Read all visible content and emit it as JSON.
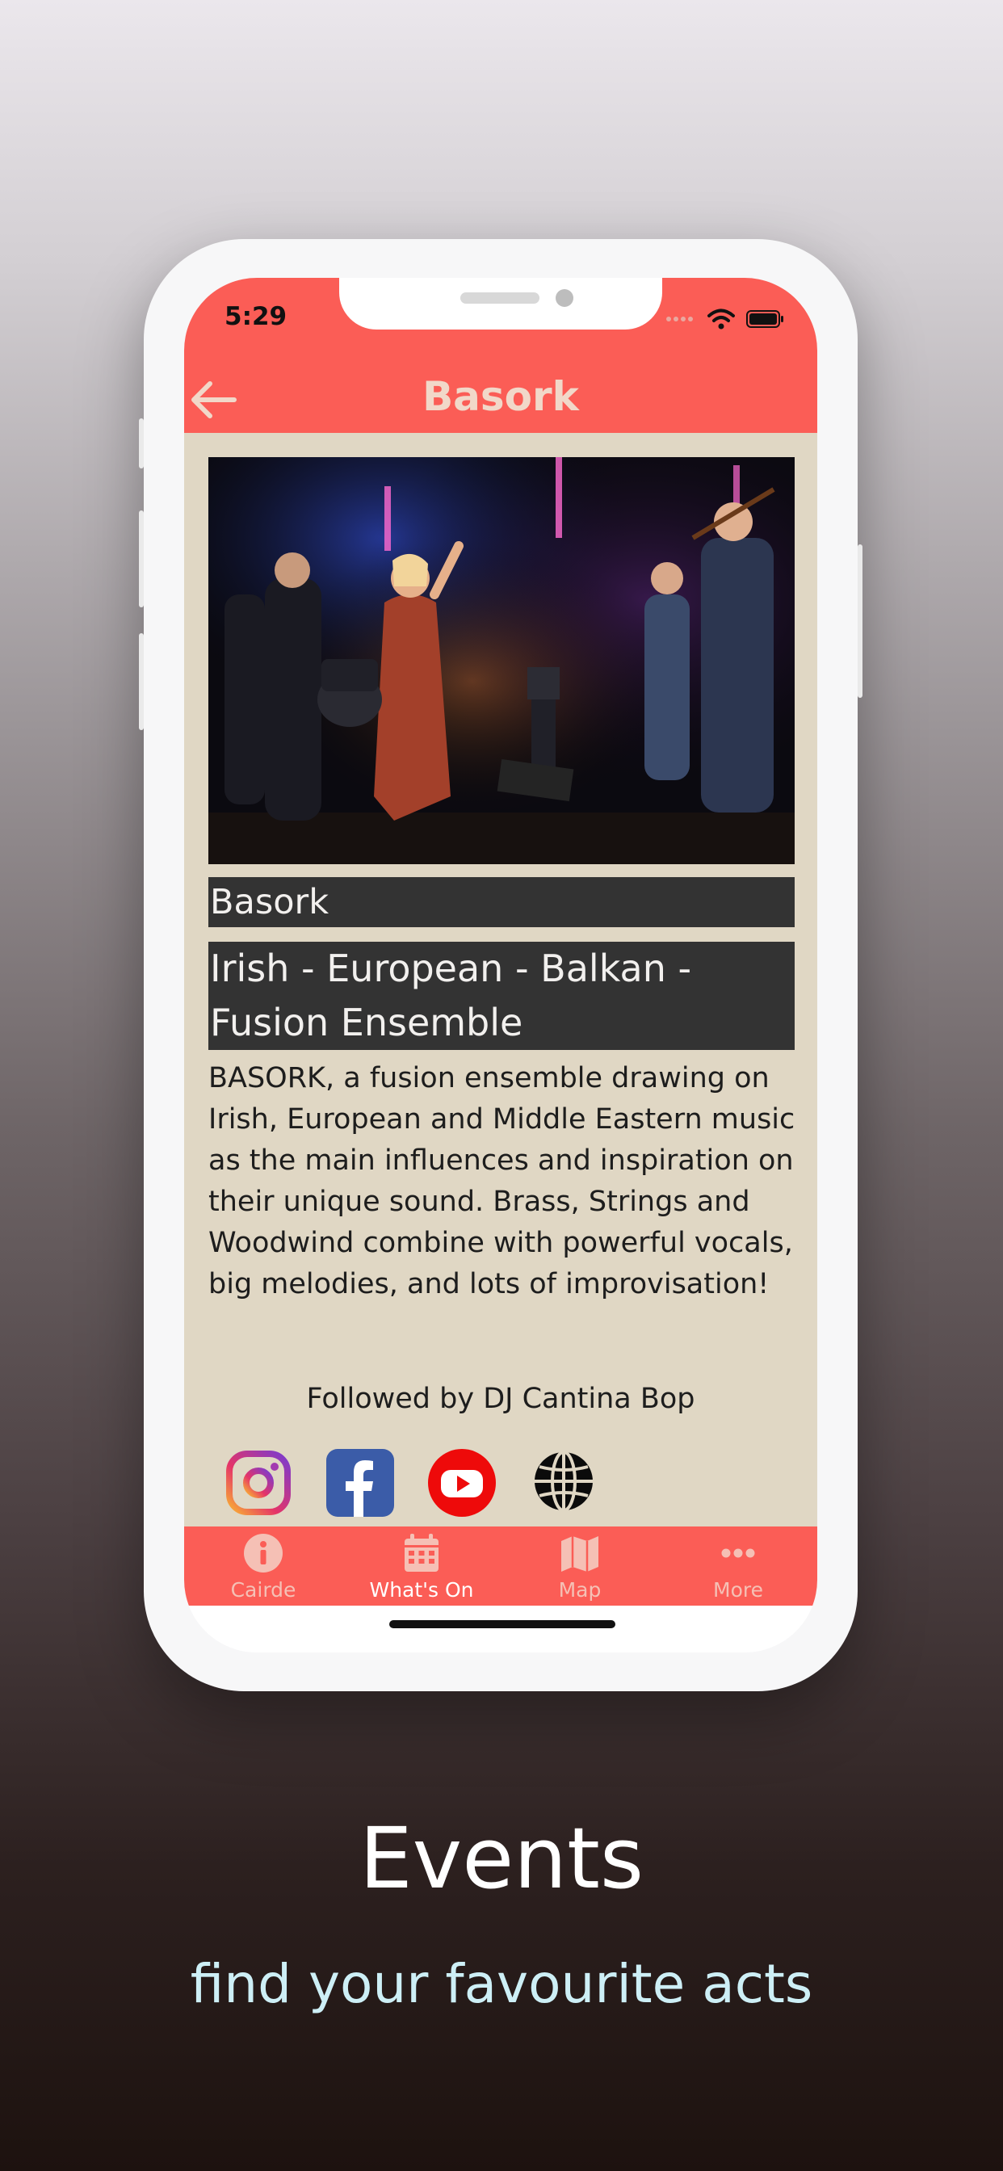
{
  "status_bar": {
    "time": "5:29"
  },
  "navbar": {
    "title": "Basork"
  },
  "event": {
    "name": "Basork",
    "genre": "Irish - European - Balkan - Fusion Ensemble",
    "description": "BASORK, a fusion ensemble drawing on Irish, European and Middle Eastern music as the main influences and inspiration on their unique sound. Brass, Strings and Woodwind combine with powerful vocals, big melodies, and lots of improvisation!",
    "followed_by": "Followed by DJ Cantina Bop"
  },
  "social_links": [
    {
      "icon": "instagram-icon"
    },
    {
      "icon": "facebook-icon"
    },
    {
      "icon": "youtube-icon"
    },
    {
      "icon": "globe-icon"
    }
  ],
  "tabs": [
    {
      "label": "Cairde",
      "icon": "info-icon",
      "active": false
    },
    {
      "label": "What's On",
      "icon": "calendar-icon",
      "active": true
    },
    {
      "label": "Map",
      "icon": "map-icon",
      "active": false
    },
    {
      "label": "More",
      "icon": "more-icon",
      "active": false
    }
  ],
  "marketing": {
    "headline": "Events",
    "subline": "find your favourite acts"
  },
  "colors": {
    "brand_red": "#fb5d56",
    "content_bg": "#e0d7c4",
    "label_bg": "#333333",
    "subline": "#cdeff6"
  }
}
